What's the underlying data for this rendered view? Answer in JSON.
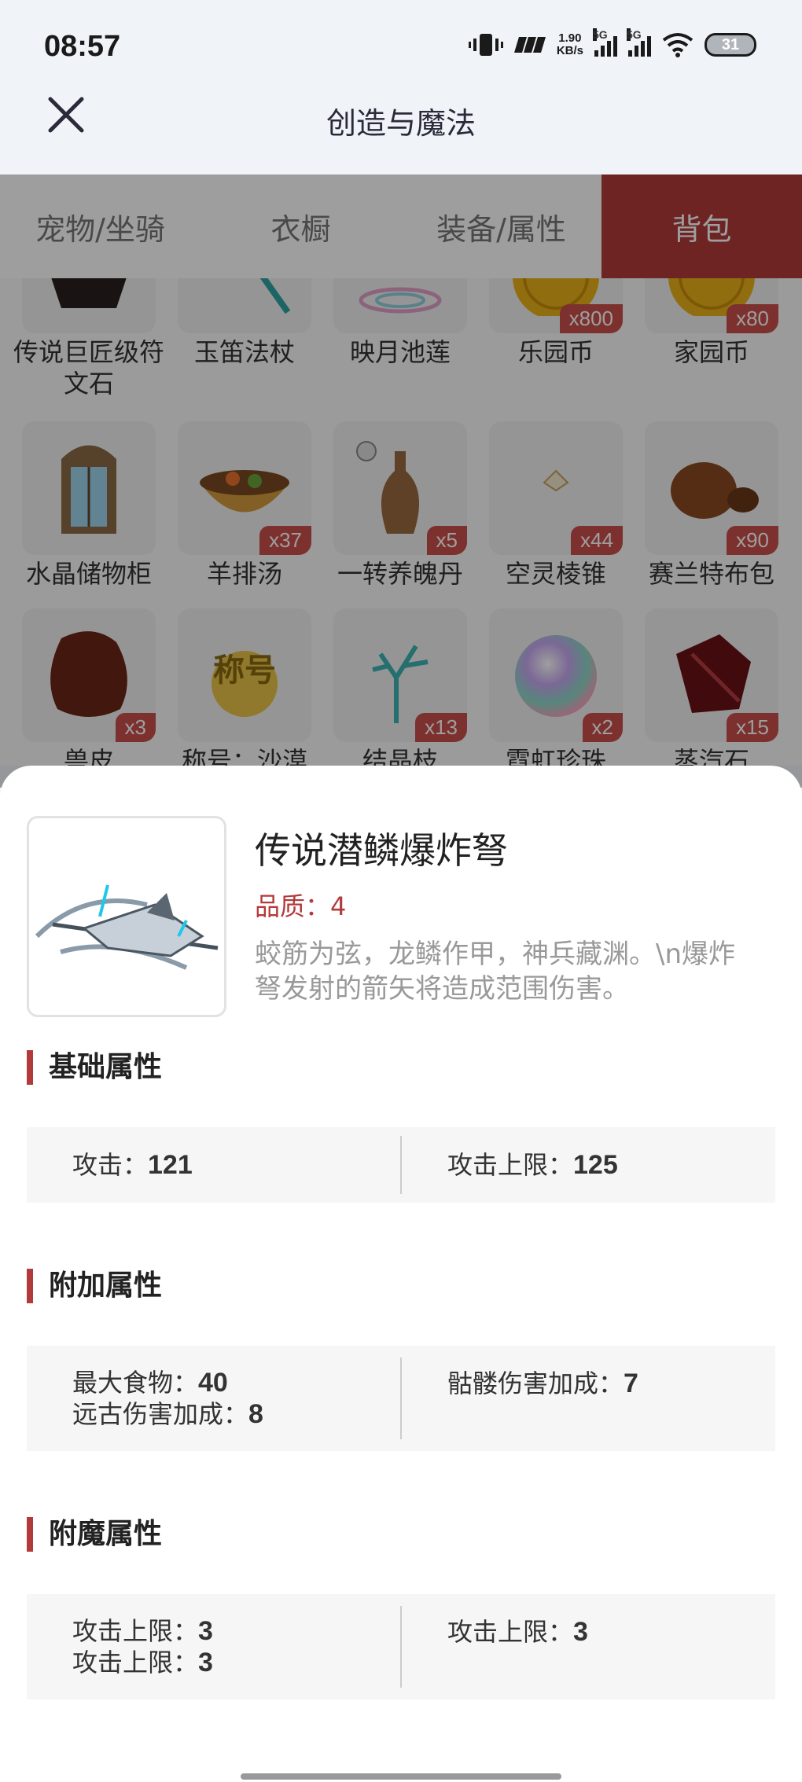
{
  "status": {
    "time": "08:57",
    "speed_top": "1.90",
    "speed_bottom": "KB/s",
    "sim1": "5G",
    "sim2": "5G",
    "battery": "31"
  },
  "header": {
    "title": "创造与魔法"
  },
  "tabs": [
    {
      "label": "宠物/坐骑",
      "active": false
    },
    {
      "label": "衣橱",
      "active": false
    },
    {
      "label": "装备/属性",
      "active": false
    },
    {
      "label": "背包",
      "active": true
    }
  ],
  "grid": {
    "row1": [
      {
        "name": "传说巨匠级符文石",
        "count": ""
      },
      {
        "name": "玉笛法杖",
        "count": ""
      },
      {
        "name": "映月池莲",
        "count": ""
      },
      {
        "name": "乐园币",
        "count": "x800"
      },
      {
        "name": "家园币",
        "count": "x80"
      }
    ],
    "row2": [
      {
        "name": "水晶储物柜",
        "count": ""
      },
      {
        "name": "羊排汤",
        "count": "x37"
      },
      {
        "name": "一转养魄丹",
        "count": "x5"
      },
      {
        "name": "空灵棱锥",
        "count": "x44"
      },
      {
        "name": "赛兰特布包",
        "count": "x90"
      }
    ],
    "row3": [
      {
        "name": "兽皮",
        "count": "x3"
      },
      {
        "name": "称号：沙漠",
        "count": ""
      },
      {
        "name": "结晶枝",
        "count": "x13"
      },
      {
        "name": "霓虹珍珠",
        "count": "x2"
      },
      {
        "name": "蒸汽石",
        "count": "x15"
      }
    ],
    "title_badge": "称号"
  },
  "detail": {
    "title": "传说潜鳞爆炸弩",
    "quality": "品质：4",
    "description": "蛟筋为弦，龙鳞作甲，神兵藏渊。\\n爆炸弩发射的箭矢将造成范围伤害。",
    "sections": {
      "basic": {
        "title": "基础属性",
        "left": [
          {
            "label": "攻击：",
            "value": "121"
          }
        ],
        "right": [
          {
            "label": "攻击上限：",
            "value": "125"
          }
        ]
      },
      "extra": {
        "title": "附加属性",
        "left": [
          {
            "label": "最大食物：",
            "value": "40"
          },
          {
            "label": "远古伤害加成：",
            "value": "8"
          }
        ],
        "right": [
          {
            "label": "骷髅伤害加成：",
            "value": "7"
          }
        ]
      },
      "enchant": {
        "title": "附魔属性",
        "left": [
          {
            "label": "攻击上限：",
            "value": "3"
          },
          {
            "label": "攻击上限：",
            "value": "3"
          }
        ],
        "right": [
          {
            "label": "攻击上限：",
            "value": "3"
          }
        ]
      }
    }
  },
  "colors": {
    "accent": "#b33a3a",
    "badge": "#c9504c",
    "overlay": "rgba(0,0,0,0.38)"
  }
}
